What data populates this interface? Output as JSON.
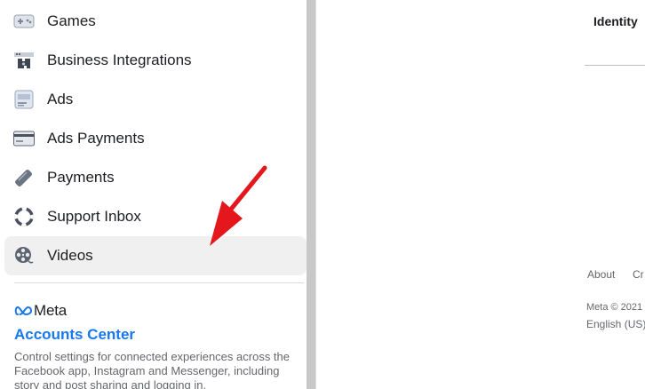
{
  "sidebar": {
    "items": [
      {
        "label": "Games",
        "icon": "gamepad-icon"
      },
      {
        "label": "Business Integrations",
        "icon": "business-integrations-icon"
      },
      {
        "label": "Ads",
        "icon": "ads-icon"
      },
      {
        "label": "Ads Payments",
        "icon": "credit-card-icon"
      },
      {
        "label": "Payments",
        "icon": "payments-tag-icon"
      },
      {
        "label": "Support Inbox",
        "icon": "lifebuoy-icon"
      },
      {
        "label": "Videos",
        "icon": "film-reel-icon",
        "active": true
      }
    ],
    "meta_label": "Meta",
    "accounts_center": "Accounts Center",
    "accounts_center_desc": "Control settings for connected experiences across the Facebook app, Instagram and Messenger, including story and post sharing and logging in."
  },
  "main": {
    "heading": "Identity",
    "footer": {
      "about": "About",
      "cr": "Cr",
      "copyright": "Meta © 2021",
      "language": "English (US)"
    }
  },
  "colors": {
    "accent": "#1877f2",
    "arrow": "#e3171c",
    "active_bg": "#f0f0f0"
  }
}
